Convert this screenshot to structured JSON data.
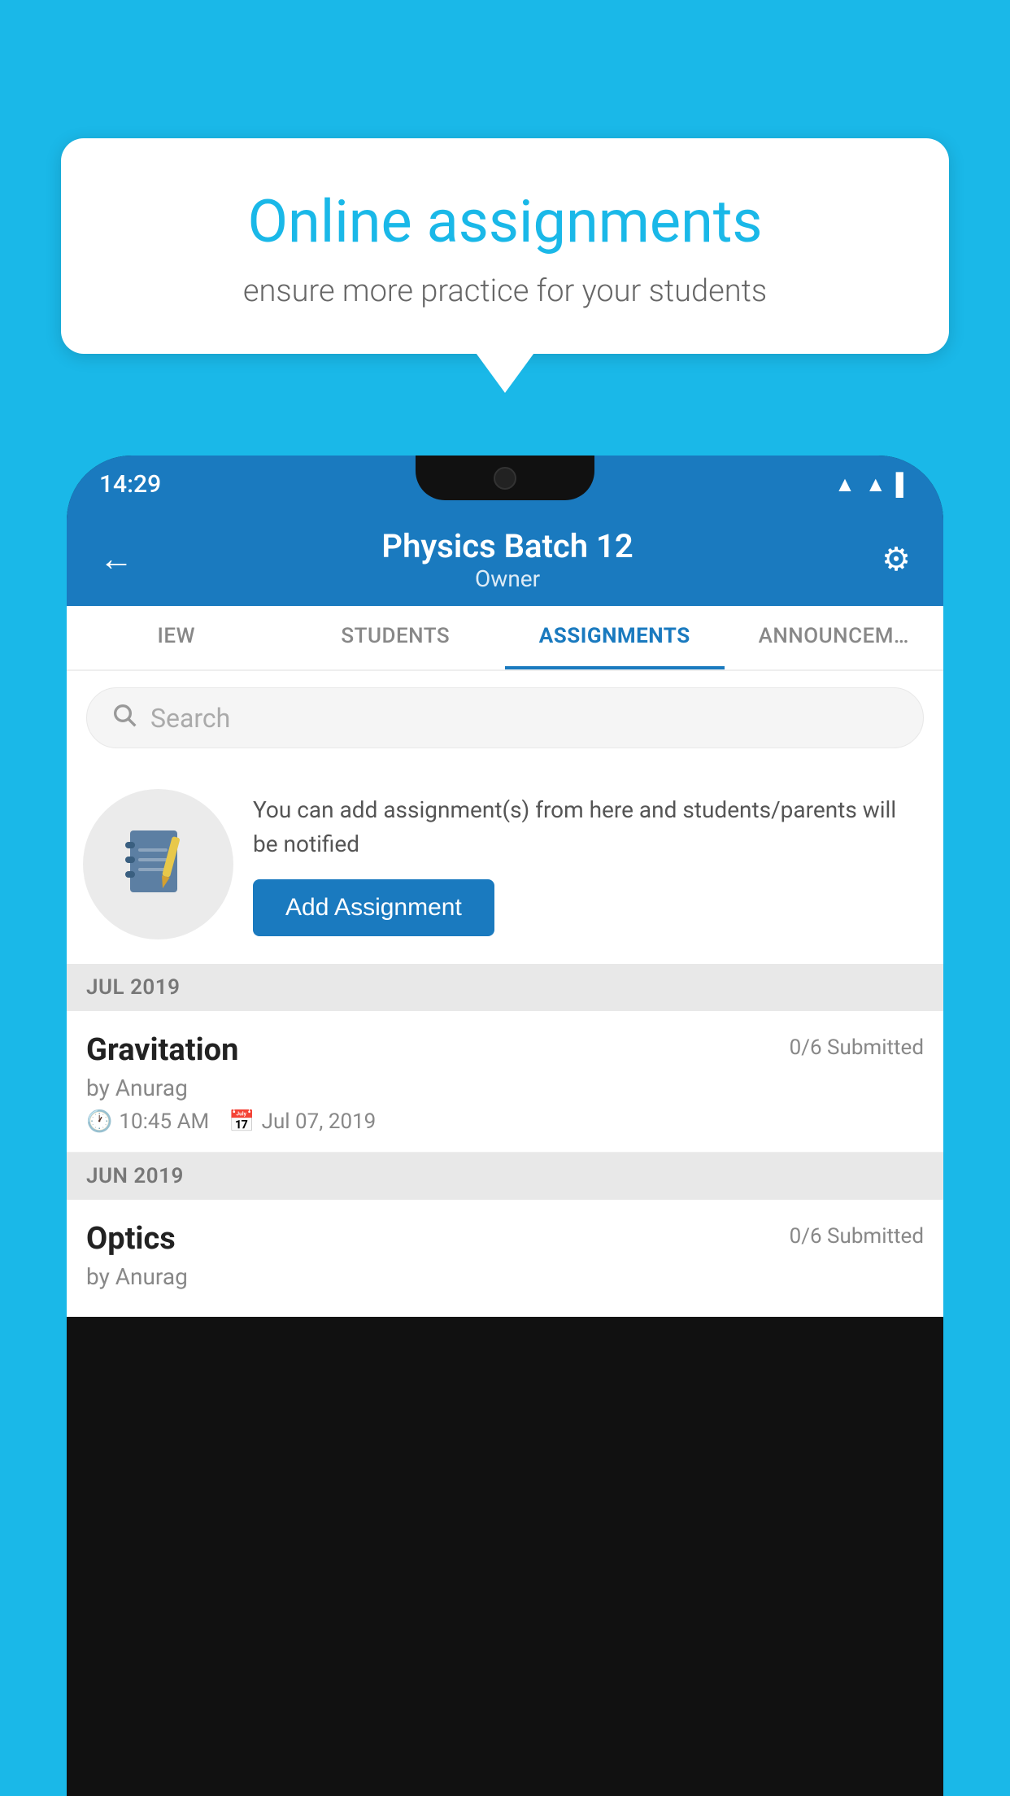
{
  "background_color": "#1ab8e8",
  "speech_bubble": {
    "title": "Online assignments",
    "subtitle": "ensure more practice for your students"
  },
  "status_bar": {
    "time": "14:29",
    "icons": [
      "wifi",
      "signal",
      "battery"
    ]
  },
  "app_header": {
    "title": "Physics Batch 12",
    "subtitle": "Owner",
    "back_label": "←",
    "settings_label": "⚙"
  },
  "tabs": [
    {
      "label": "IEW",
      "active": false
    },
    {
      "label": "STUDENTS",
      "active": false
    },
    {
      "label": "ASSIGNMENTS",
      "active": true
    },
    {
      "label": "ANNOUNCEM…",
      "active": false
    }
  ],
  "search": {
    "placeholder": "Search"
  },
  "promo": {
    "description": "You can add assignment(s) from here and students/parents will be notified",
    "button_label": "Add Assignment"
  },
  "sections": [
    {
      "month": "JUL 2019",
      "assignments": [
        {
          "title": "Gravitation",
          "submitted": "0/6 Submitted",
          "by": "by Anurag",
          "time": "10:45 AM",
          "date": "Jul 07, 2019"
        }
      ]
    },
    {
      "month": "JUN 2019",
      "assignments": [
        {
          "title": "Optics",
          "submitted": "0/6 Submitted",
          "by": "by Anurag",
          "time": "",
          "date": ""
        }
      ]
    }
  ]
}
